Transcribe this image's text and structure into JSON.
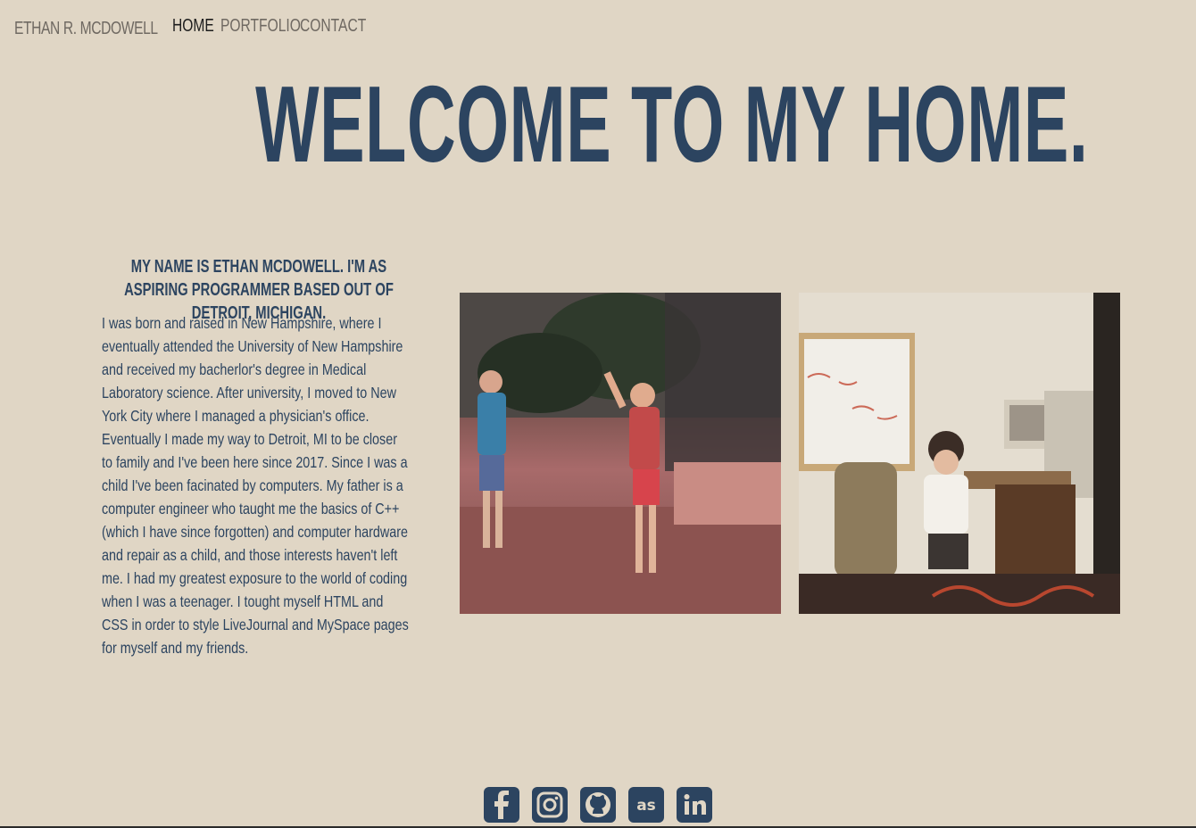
{
  "nav": {
    "brand": "ETHAN R. MCDOWELL",
    "links": [
      {
        "label": "HOME",
        "active": true
      },
      {
        "label": "PORTFOLIO",
        "active": false
      },
      {
        "label": "CONTACT",
        "active": false
      }
    ]
  },
  "hero": {
    "title": "WELCOME TO MY HOME."
  },
  "intro": {
    "heading": "MY NAME IS ETHAN MCDOWELL. I'M AS ASPIRING PROGRAMMER BASED OUT OF DETROIT, MICHIGAN.",
    "bio": "I was born and raised in New Hampshire, where I eventually attended the University of New Hampshire and received my bacherlor's degree in Medical Laboratory science. After university, I moved to New York City where I managed a physician's office. Eventually I made my way to Detroit, MI to be closer to family and I've been here since 2017. Since I was a child I've been facinated by computers. My father is a computer engineer who taught me the basics of C++ (which I have since forgotten) and computer hardware and repair as a child, and those interests haven't left me. I had my greatest exposure to the world of coding when I was a teenager. I tought myself HTML and CSS in order to style LiveJournal and MySpace pages for myself and my friends."
  },
  "photos": [
    {
      "name": "childhood-photo-street"
    },
    {
      "name": "childhood-photo-computer"
    }
  ],
  "social": [
    {
      "name": "facebook-icon"
    },
    {
      "name": "instagram-icon"
    },
    {
      "name": "github-icon"
    },
    {
      "name": "lastfm-icon"
    },
    {
      "name": "linkedin-icon"
    }
  ],
  "colors": {
    "background": "#e0d6c5",
    "accent": "#2c4460",
    "nav_text": "#6f6962",
    "nav_active": "#1d1d1d"
  }
}
